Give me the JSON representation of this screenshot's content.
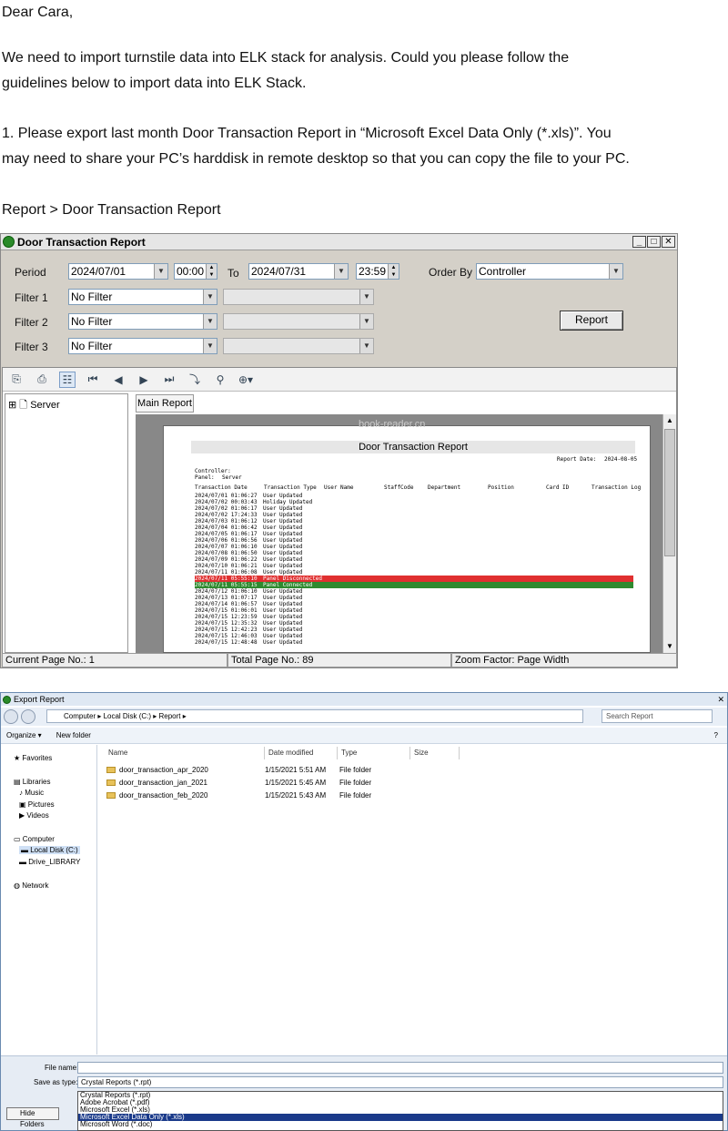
{
  "letter": {
    "greeting": "Dear Cara,",
    "para1_line1": "We need to import turnstile data into ELK stack for analysis. Could you please follow the",
    "para1_line2": "guidelines below to import data into ELK Stack.",
    "step1_line1": "1.  Please export last month Door Transaction Report in  “Microsoft Excel Data Only (*.xls)”. You",
    "step1_line2": "may need to share your PC’s harddisk in remote desktop so that you can copy the file to your PC.",
    "menu_path": "Report > Door Transaction Report"
  },
  "report_window": {
    "title": "Door Transaction Report",
    "period_label": "Period",
    "from_date": "2024/07/01",
    "from_time": "00:00",
    "to_label": "To",
    "to_date": "2024/07/31",
    "to_time": "23:59",
    "order_by_label": "Order By",
    "order_by_value": "Controller",
    "filter1_label": "Filter 1",
    "filter2_label": "Filter 2",
    "filter3_label": "Filter 3",
    "filter_value": "No Filter",
    "report_button": "Report",
    "tree_root": "Server",
    "tab_main": "Main Report",
    "status_current": "Current Page No.: 1",
    "status_total": "Total Page No.: 89",
    "status_zoom": "Zoom Factor: Page Width"
  },
  "report_page": {
    "title": "Door Transaction Report",
    "report_date_label": "Report Date:",
    "report_date": "2024-08-05",
    "controller_label": "Controller:",
    "panel_label": "Panel:",
    "panel_value": "Server",
    "columns": [
      "Transaction Date",
      "Transaction Type",
      "User Name",
      "StaffCode",
      "Department",
      "Position",
      "Card ID",
      "Transaction Log"
    ],
    "rows": [
      {
        "d": "2024/07/01  01:06:27",
        "t": "User Updated",
        "hl": ""
      },
      {
        "d": "2024/07/02  00:03:43",
        "t": "Holiday Updated",
        "hl": ""
      },
      {
        "d": "2024/07/02  01:06:17",
        "t": "User Updated",
        "hl": ""
      },
      {
        "d": "2024/07/02  17:24:33",
        "t": "User Updated",
        "hl": ""
      },
      {
        "d": "2024/07/03  01:06:12",
        "t": "User Updated",
        "hl": ""
      },
      {
        "d": "2024/07/04  01:06:42",
        "t": "User Updated",
        "hl": ""
      },
      {
        "d": "2024/07/05  01:06:17",
        "t": "User Updated",
        "hl": ""
      },
      {
        "d": "2024/07/06  01:06:56",
        "t": "User Updated",
        "hl": ""
      },
      {
        "d": "2024/07/07  01:06:10",
        "t": "User Updated",
        "hl": ""
      },
      {
        "d": "2024/07/08  01:06:50",
        "t": "User Updated",
        "hl": ""
      },
      {
        "d": "2024/07/09  01:06:22",
        "t": "User Updated",
        "hl": ""
      },
      {
        "d": "2024/07/10  01:06:21",
        "t": "User Updated",
        "hl": ""
      },
      {
        "d": "2024/07/11  01:06:08",
        "t": "User Updated",
        "hl": ""
      },
      {
        "d": "2024/07/11  05:55:10",
        "t": "Panel Disconnected",
        "hl": "red"
      },
      {
        "d": "2024/07/11  05:55:15",
        "t": "Panel Connected",
        "hl": "green"
      },
      {
        "d": "2024/07/12  01:06:10",
        "t": "User Updated",
        "hl": ""
      },
      {
        "d": "2024/07/13  01:07:17",
        "t": "User Updated",
        "hl": ""
      },
      {
        "d": "2024/07/14  01:06:57",
        "t": "User Updated",
        "hl": ""
      },
      {
        "d": "2024/07/15  01:06:01",
        "t": "User Updated",
        "hl": ""
      },
      {
        "d": "2024/07/15  12:23:59",
        "t": "User Updated",
        "hl": ""
      },
      {
        "d": "2024/07/15  12:35:32",
        "t": "User Updated",
        "hl": ""
      },
      {
        "d": "2024/07/15  12:42:23",
        "t": "User Updated",
        "hl": ""
      },
      {
        "d": "2024/07/15  12:46:03",
        "t": "User Updated",
        "hl": ""
      },
      {
        "d": "2024/07/15  12:48:48",
        "t": "User Updated",
        "hl": ""
      }
    ],
    "highlight_colors": {
      "red": "#e03030",
      "green": "#2f8a2f"
    }
  },
  "export_dialog": {
    "title": "Export Report",
    "address": "Computer ▸ Local Disk (C:) ▸ Report ▸",
    "search_placeholder": "Search Report",
    "organize": "Organize ▾",
    "new_folder": "New folder",
    "nav": {
      "favorites": "Favorites",
      "libraries": "Libraries",
      "music": "Music",
      "pictures": "Pictures",
      "videos": "Videos",
      "computer": "Computer",
      "local_disk": "Local Disk (C:)",
      "drive2": "Drive_LIBRARY",
      "network": "Network"
    },
    "columns": {
      "name": "Name",
      "date": "Date modified",
      "type": "Type",
      "size": "Size"
    },
    "files": [
      {
        "name": "door_transaction_apr_2020",
        "date": "1/15/2021 5:51 AM",
        "type": "File folder"
      },
      {
        "name": "door_transaction_jan_2021",
        "date": "1/15/2021 5:45 AM",
        "type": "File folder"
      },
      {
        "name": "door_transaction_feb_2020",
        "date": "1/15/2021 5:43 AM",
        "type": "File folder"
      }
    ],
    "file_name_label": "File name:",
    "save_type_label": "Save as type:",
    "save_type_value": "Crystal Reports (*.rpt)",
    "type_options": [
      {
        "label": "Crystal Reports (*.rpt)",
        "selected": false
      },
      {
        "label": "Adobe Acrobat (*.pdf)",
        "selected": false
      },
      {
        "label": "Microsoft Excel (*.xls)",
        "selected": false
      },
      {
        "label": "Microsoft Excel Data Only (*.xls)",
        "selected": true
      },
      {
        "label": "Microsoft Word (*.doc)",
        "selected": false
      }
    ],
    "hide_folders": "Hide Folders"
  },
  "watermark": "book-reader.cn"
}
